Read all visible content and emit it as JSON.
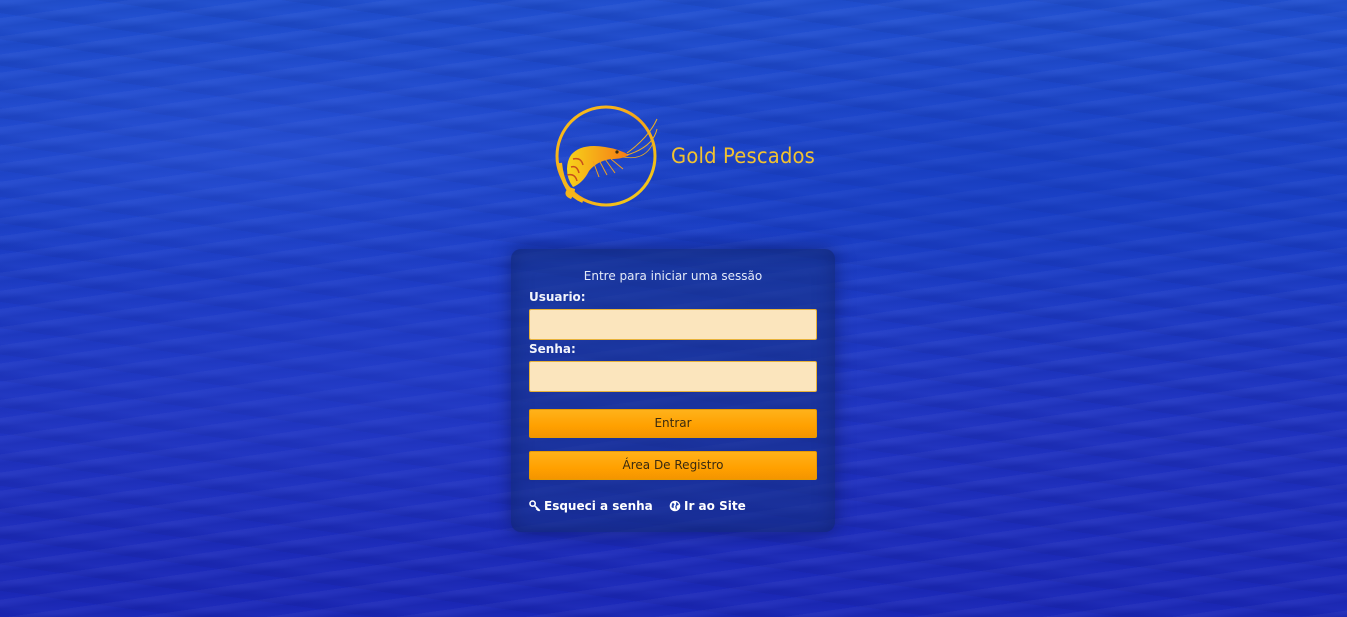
{
  "brand": {
    "name": "Gold Pescados"
  },
  "login": {
    "title": "Entre para iniciar uma sessão",
    "username_label": "Usuario:",
    "username_value": "",
    "password_label": "Senha:",
    "password_value": "",
    "submit_label": "Entrar",
    "register_label": "Área De Registro"
  },
  "links": {
    "forgot": {
      "label": "Esqueci a senha",
      "icon": "key-icon"
    },
    "site": {
      "label": "Ir ao Site",
      "icon": "globe-icon"
    }
  },
  "colors": {
    "background": "#1e3ec6",
    "accent": "#ffa500",
    "brand_text": "#f2c230",
    "input_bg": "#fbe5bd"
  }
}
